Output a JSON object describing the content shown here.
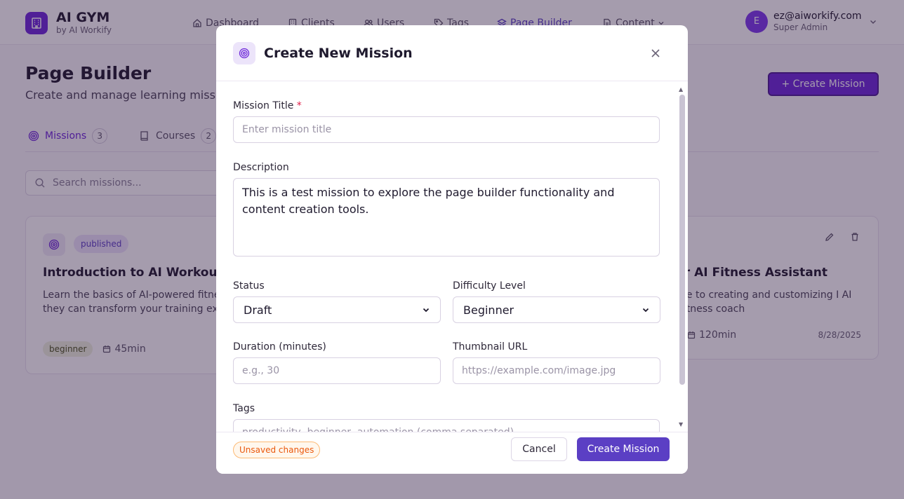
{
  "app": {
    "name": "AI GYM",
    "byline": "by AI Workify"
  },
  "nav": {
    "items": [
      {
        "label": "Dashboard",
        "icon": "home-icon"
      },
      {
        "label": "Clients",
        "icon": "building-icon"
      },
      {
        "label": "Users",
        "icon": "users-icon"
      },
      {
        "label": "Tags",
        "icon": "tag-icon"
      },
      {
        "label": "Page Builder",
        "icon": "layers-icon",
        "active": true
      },
      {
        "label": "Content",
        "icon": "file-icon",
        "has_dropdown": true
      }
    ]
  },
  "user": {
    "initial": "E",
    "email": "ez@aiworkify.com",
    "role": "Super Admin"
  },
  "page": {
    "title": "Page Builder",
    "subtitle": "Create and manage learning missions and courses",
    "create_label": "+ Create Mission"
  },
  "tabs": [
    {
      "label": "Missions",
      "count": "3",
      "icon": "target-icon",
      "active": true
    },
    {
      "label": "Courses",
      "count": "2",
      "icon": "book-icon"
    }
  ],
  "search": {
    "placeholder": "Search missions..."
  },
  "cards": [
    {
      "status": "published",
      "title": "Introduction to AI Workouts",
      "description": "Learn the basics of AI-powered fitness and how they can transform your training experience",
      "difficulty": "beginner",
      "duration": "45min"
    },
    {
      "title": "our AI Fitness Assistant",
      "description": "de to creating and customizing I AI fitness coach",
      "duration": "120min",
      "date": "8/28/2025"
    }
  ],
  "modal": {
    "title": "Create New Mission",
    "fields": {
      "title_label": "Mission Title",
      "title_required": "*",
      "title_placeholder": "Enter mission title",
      "description_label": "Description",
      "description_value": "This is a test mission to explore the page builder functionality and content creation tools.",
      "status_label": "Status",
      "status_value": "Draft",
      "difficulty_label": "Difficulty Level",
      "difficulty_value": "Beginner",
      "duration_label": "Duration (minutes)",
      "duration_placeholder": "e.g., 30",
      "thumbnail_label": "Thumbnail URL",
      "thumbnail_placeholder": "https://example.com/image.jpg",
      "tags_label": "Tags",
      "tags_placeholder": "productivity, beginner, automation (comma separated)"
    },
    "footer": {
      "unsaved": "Unsaved changes",
      "cancel": "Cancel",
      "submit": "Create Mission"
    }
  },
  "colors": {
    "brand": "#6d28d9",
    "primary_button": "#5b3fc4",
    "unsaved": "#ea580c"
  }
}
